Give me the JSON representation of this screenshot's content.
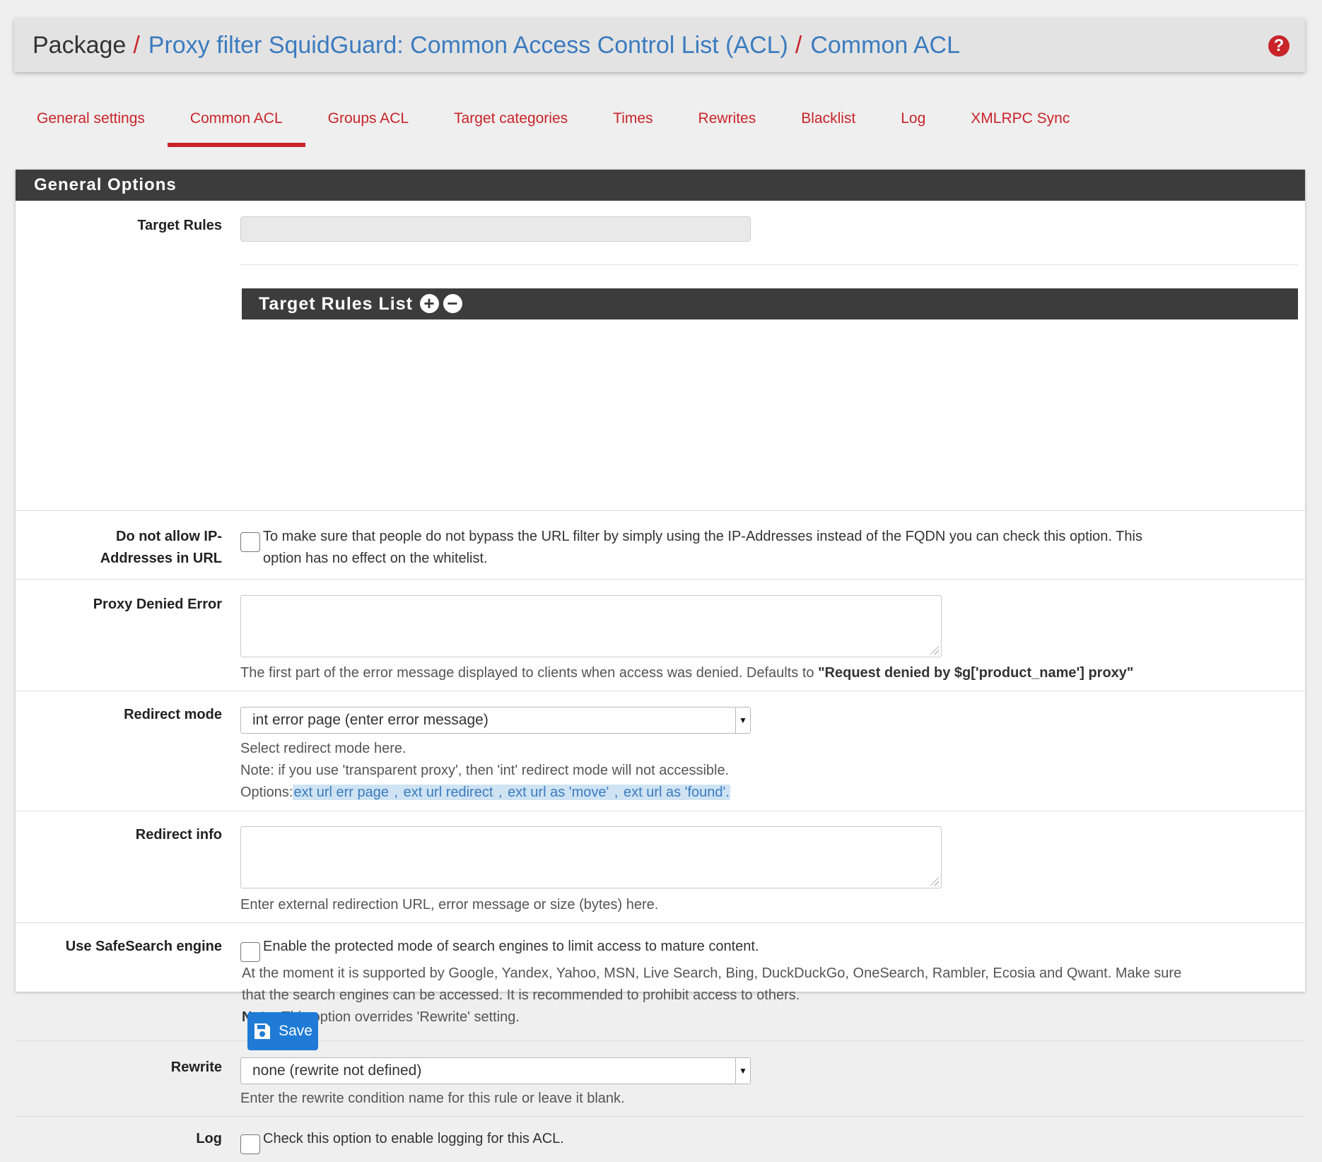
{
  "breadcrumb": {
    "root": "Package",
    "separator": "/",
    "level1": "Proxy filter SquidGuard: Common Access Control List (ACL)",
    "level2": "Common ACL",
    "help_icon": "question-circle-icon"
  },
  "tabs": [
    {
      "label": "General settings",
      "active": false
    },
    {
      "label": "Common ACL",
      "active": true
    },
    {
      "label": "Groups ACL",
      "active": false
    },
    {
      "label": "Target categories",
      "active": false
    },
    {
      "label": "Times",
      "active": false
    },
    {
      "label": "Rewrites",
      "active": false
    },
    {
      "label": "Blacklist",
      "active": false
    },
    {
      "label": "Log",
      "active": false
    },
    {
      "label": "XMLRPC Sync",
      "active": false
    }
  ],
  "panel": {
    "title": "General Options",
    "target_rules": {
      "label": "Target Rules",
      "value": "",
      "list_title": "Target Rules List",
      "add_icon": "plus-circle-icon",
      "remove_icon": "minus-circle-icon"
    },
    "no_ip": {
      "label_line1": "Do not allow IP-",
      "label_line2": "Addresses in URL",
      "checked": false,
      "text_line1": "To make sure that people do not bypass the URL filter by simply using the IP-Addresses instead of the FQDN you can check this option. This",
      "text_line2": "option has no effect on the whitelist."
    },
    "proxy_denied": {
      "label": "Proxy Denied Error",
      "value": "",
      "help_prefix": "The first part of the error message displayed to clients when access was denied. Defaults to ",
      "help_bold": "\"Request denied by $g['product_name'] proxy\""
    },
    "redirect_mode": {
      "label": "Redirect mode",
      "selected": "int error page (enter error message)",
      "help_line1": "Select redirect mode here.",
      "help_line2": "Note: if you use 'transparent proxy', then 'int' redirect mode will not accessible.",
      "options_prefix": "Options:",
      "options": [
        "ext url err page",
        "ext url redirect",
        "ext url as 'move'",
        "ext url as 'found'."
      ],
      "options_sep": " , "
    },
    "redirect_info": {
      "label": "Redirect info",
      "value": "",
      "help": "Enter external redirection URL, error message or size (bytes) here."
    },
    "safesearch": {
      "label": "Use SafeSearch engine",
      "checked": false,
      "text": "Enable the protected mode of search engines to limit access to mature content.",
      "help_line1": "At the moment it is supported by Google, Yandex, Yahoo, MSN, Live Search, Bing, DuckDuckGo, OneSearch, Rambler, Ecosia and Qwant. Make sure",
      "help_line2": "that the search engines can be accessed. It is recommended to prohibit access to others.",
      "note_bold": "Note:",
      "note_text": " This option overrides 'Rewrite' setting."
    },
    "rewrite": {
      "label": "Rewrite",
      "selected": "none (rewrite not defined)",
      "help": "Enter the rewrite condition name for this rule or leave it blank."
    },
    "log": {
      "label": "Log",
      "checked": false,
      "text": "Check this option to enable logging for this ACL."
    }
  },
  "save_button": {
    "label": "Save",
    "icon": "floppy-disk-icon"
  },
  "colors": {
    "accent_red": "#c8242a",
    "link_blue": "#3b7bbf",
    "panel_header": "#3c3c3c",
    "button_blue": "#1f7bd6",
    "annotation_arrow": "#1b4fa8"
  }
}
